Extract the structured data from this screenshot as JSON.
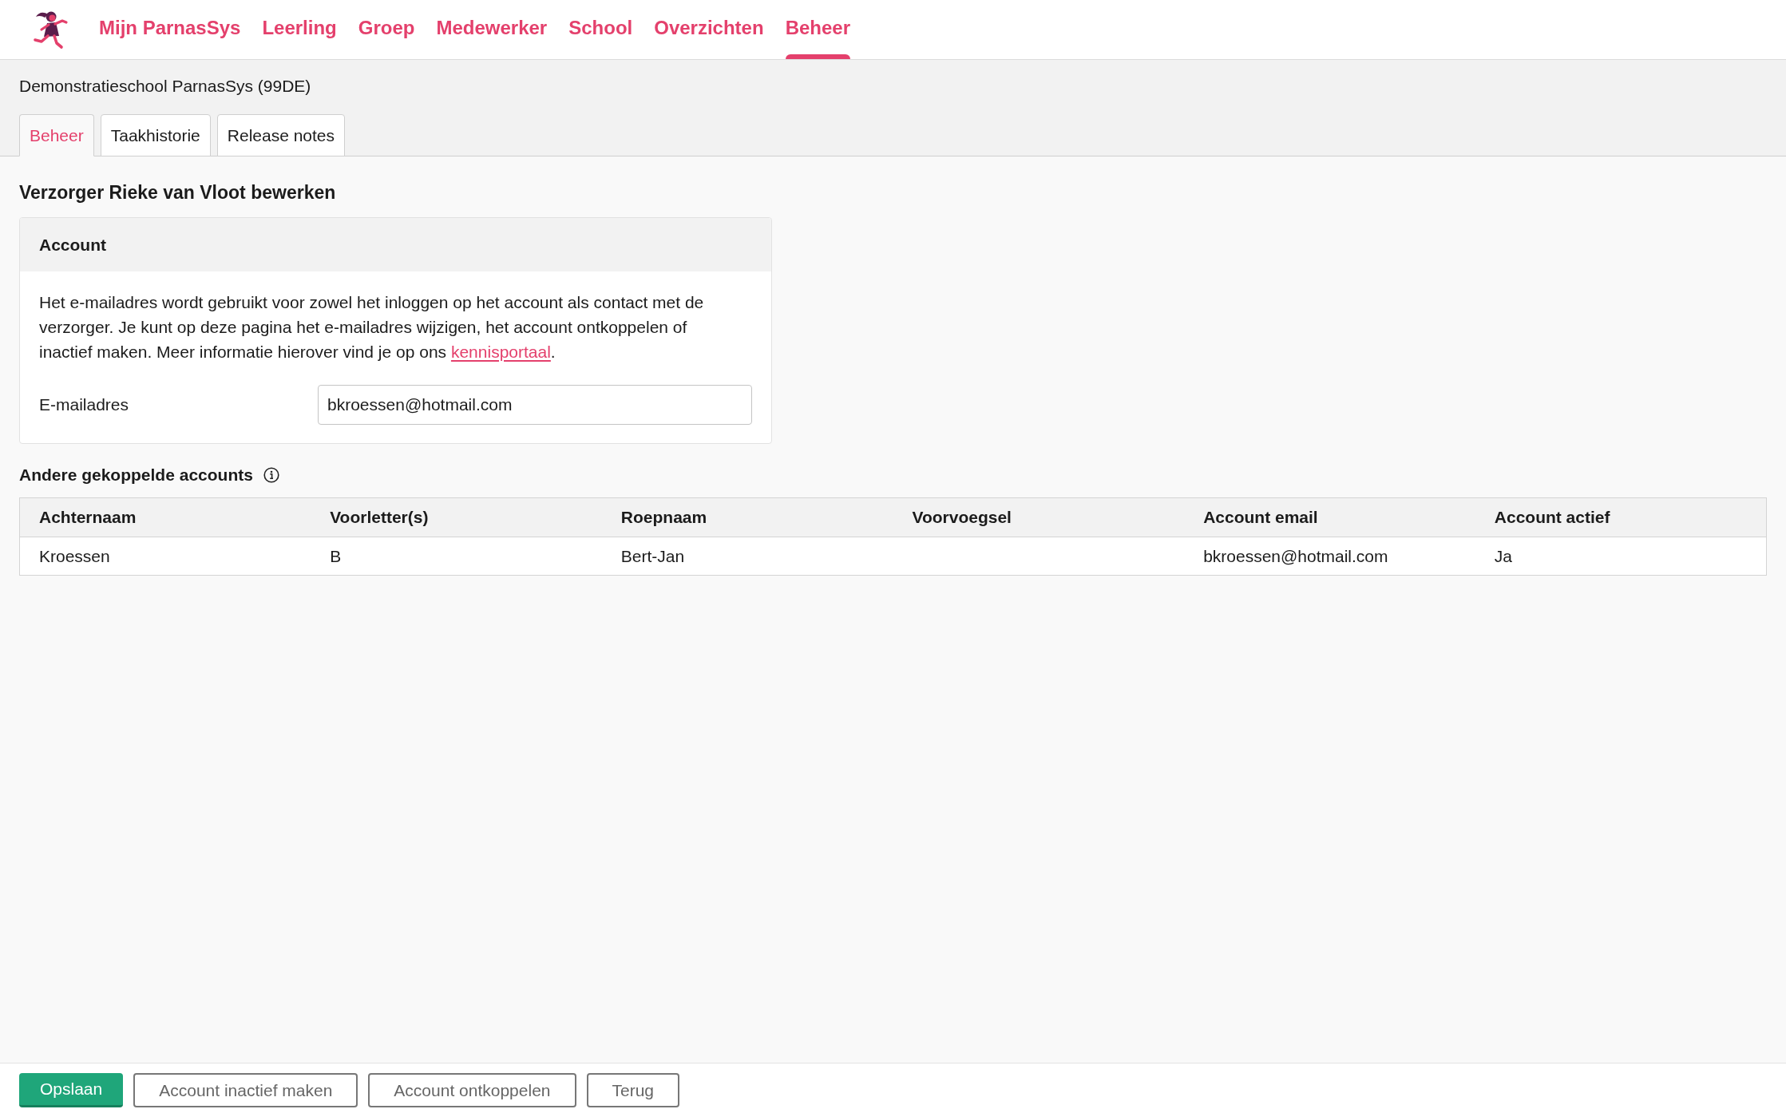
{
  "nav": {
    "items": [
      {
        "label": "Mijn ParnasSys",
        "selected": false
      },
      {
        "label": "Leerling",
        "selected": false
      },
      {
        "label": "Groep",
        "selected": false
      },
      {
        "label": "Medewerker",
        "selected": false
      },
      {
        "label": "School",
        "selected": false
      },
      {
        "label": "Overzichten",
        "selected": false
      },
      {
        "label": "Beheer",
        "selected": true
      }
    ]
  },
  "school": {
    "name": "Demonstratieschool ParnasSys (99DE)"
  },
  "tabs": [
    {
      "label": "Beheer",
      "selected": true
    },
    {
      "label": "Taakhistorie",
      "selected": false
    },
    {
      "label": "Release notes",
      "selected": false
    }
  ],
  "page_title": "Verzorger Rieke van Vloot bewerken",
  "account_card": {
    "title": "Account",
    "description": {
      "text": "Het e-mailadres wordt gebruikt voor zowel het inloggen op het account als contact met de verzorger. Je kunt op deze pagina het e-mailadres wijzigen, het account ontkoppelen of inactief maken. Meer informatie hierover vind je op ons ",
      "link": "kennisportaal",
      "text_after": "."
    },
    "fields": [
      {
        "label": "E-mailadres",
        "value": "bkroessen@hotmail.com"
      }
    ]
  },
  "linked_accounts": {
    "title": "Andere gekoppelde accounts",
    "table": {
      "columns": [
        "Achternaam",
        "Voorletter(s)",
        "Roepnaam",
        "Voorvoegsel",
        "Account email",
        "Account actief"
      ],
      "rows": [
        {
          "cells": [
            "Kroessen",
            "B",
            "Bert-Jan",
            null,
            "bkroessen@hotmail.com",
            "Ja"
          ]
        }
      ]
    }
  },
  "footer": {
    "buttons": [
      {
        "label": "Opslaan",
        "kind": "primary"
      },
      {
        "label": "Account inactief maken",
        "kind": "secondary"
      },
      {
        "label": "Account ontkoppelen",
        "kind": "secondary"
      },
      {
        "label": "Terug",
        "kind": "secondary"
      }
    ]
  }
}
